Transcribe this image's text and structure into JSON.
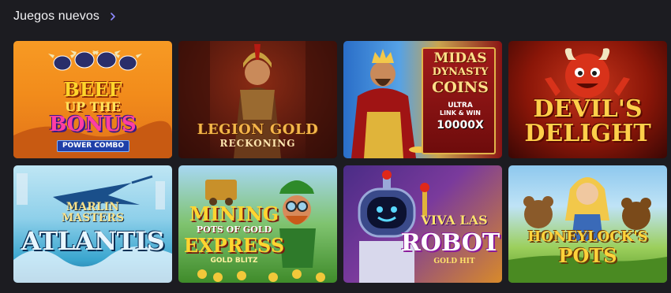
{
  "section": {
    "title": "Juegos nuevos",
    "more_icon": "chevron-right-icon",
    "accent_color": "#8d8aff"
  },
  "games": [
    {
      "id": "beef-up-the-bonus",
      "logo": [
        "BEEF",
        "UP THE",
        "BONUS"
      ],
      "badge": "POWER COMBO"
    },
    {
      "id": "legion-gold",
      "logo": [
        "LEGION GOLD",
        "RECKONING"
      ]
    },
    {
      "id": "midas-dynasty-coins",
      "logo": [
        "MIDAS",
        "DYNASTY",
        "COINS"
      ],
      "tags": [
        "ULTRA",
        "LINK & WIN",
        "10000X"
      ]
    },
    {
      "id": "devils-delight",
      "logo": [
        "DEVIL'S",
        "DELIGHT"
      ]
    },
    {
      "id": "marlin-masters-atlantis",
      "logo": [
        "MARLIN",
        "MASTERS",
        "ATLANTIS"
      ]
    },
    {
      "id": "mining-pots-of-gold-express",
      "logo": [
        "MINING",
        "POTS OF GOLD",
        "EXPRESS"
      ],
      "tags": [
        "GOLD BLITZ"
      ]
    },
    {
      "id": "viva-las-robot",
      "logo": [
        "VIVA LAS",
        "ROBOT",
        "GOLD HIT"
      ]
    },
    {
      "id": "honeylocks-pots",
      "logo": [
        "HONEYLOCK'S",
        "POTS"
      ]
    }
  ]
}
